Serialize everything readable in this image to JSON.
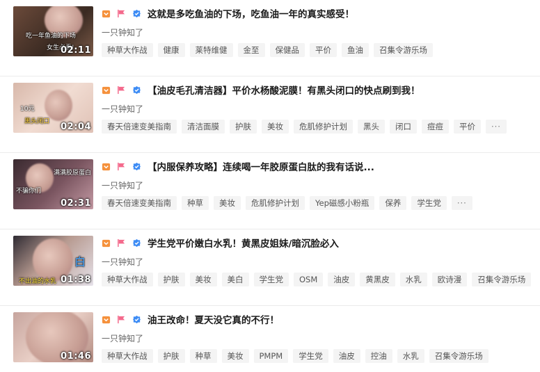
{
  "items": [
    {
      "title": "这就是多吃鱼油的下场，吃鱼油一年的真实感受！",
      "author": "一只钟知了",
      "duration": "02:11",
      "thumb_caption": "吃一年鱼油的下场",
      "thumb_caption2": "女生必看!",
      "tags": [
        "种草大作战",
        "健康",
        "莱特维健",
        "金至",
        "保健品",
        "平价",
        "鱼油",
        "召集令游乐场"
      ]
    },
    {
      "title": "【油皮毛孔清洁器】平价水杨酸泥膜！有黑头闭口的快点刷到我！",
      "author": "一只钟知了",
      "duration": "02:04",
      "thumb_caption": "黑头闭口",
      "thumb_caption2": "10元",
      "tags": [
        "春天倍速变美指南",
        "清洁面膜",
        "护肤",
        "美妆",
        "危肌修护计划",
        "黑头",
        "闭口",
        "痘痘",
        "平价",
        "···"
      ]
    },
    {
      "title": "【内服保养攻略】连续喝一年胶原蛋白肽的我有话说...",
      "author": "一只钟知了",
      "duration": "02:31",
      "thumb_caption": "不骗你们",
      "thumb_caption2": "满满胶原蛋白",
      "tags": [
        "春天倍速变美指南",
        "种草",
        "美妆",
        "危肌修护计划",
        "Yep磁感小粉瓶",
        "保养",
        "学生党",
        "···"
      ]
    },
    {
      "title": "学生党平价嫩白水乳！黄黑皮姐妹/暗沉脸必入",
      "author": "一只钟知了",
      "duration": "01:38",
      "thumb_caption": "不出油的水乳",
      "thumb_caption2": "白",
      "tags": [
        "种草大作战",
        "护肤",
        "美妆",
        "美白",
        "学生党",
        "OSM",
        "油皮",
        "黄黑皮",
        "水乳",
        "欧诗漫",
        "召集令游乐场"
      ]
    },
    {
      "title": "油王改命！夏天没它真的不行！",
      "author": "一只钟知了",
      "duration": "01:46",
      "thumb_caption": "",
      "thumb_caption2": "",
      "tags": [
        "种草大作战",
        "护肤",
        "种草",
        "美妆",
        "PMPM",
        "学生党",
        "油皮",
        "控油",
        "水乳",
        "召集令游乐场"
      ]
    }
  ],
  "colors": {
    "badge_orange": "#f5913c",
    "badge_pink": "#f46a8c",
    "badge_blue": "#3d8cf5"
  },
  "icons": [
    "orange-badge-icon",
    "pink-flag-icon",
    "blue-check-icon"
  ]
}
